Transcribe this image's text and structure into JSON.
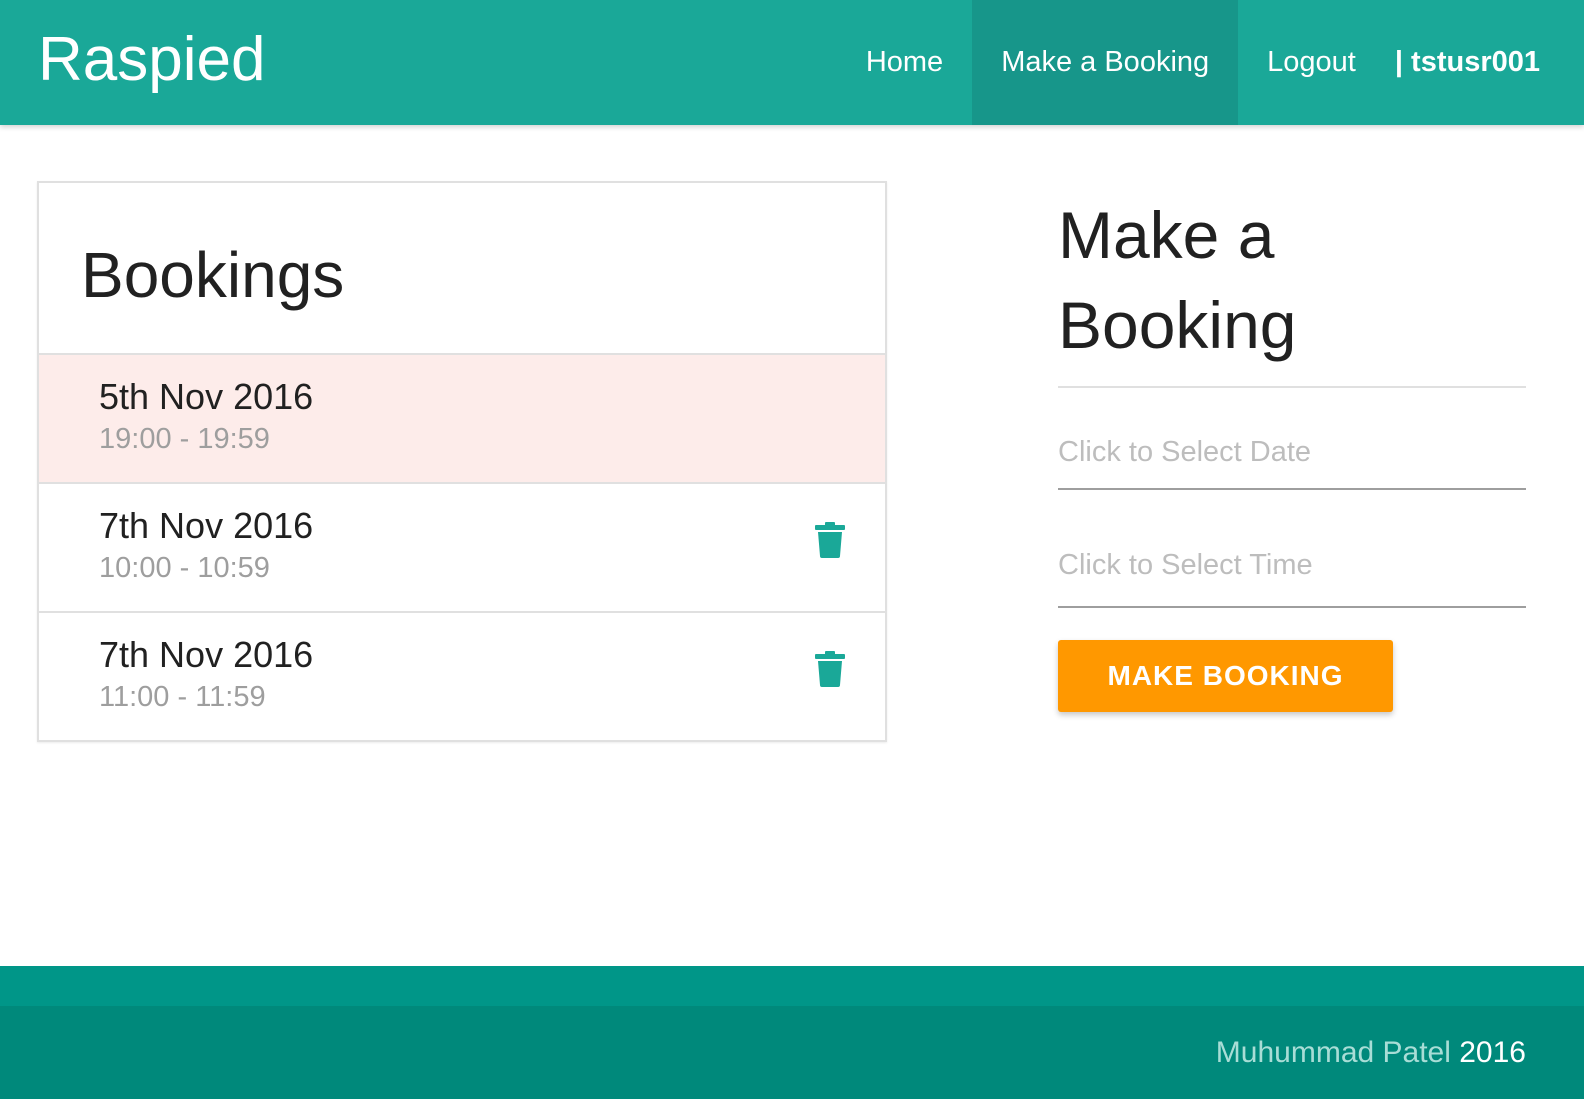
{
  "brand": "Raspied",
  "nav": {
    "home": "Home",
    "make_booking": "Make a Booking",
    "logout": "Logout",
    "user": "| tstusr001"
  },
  "bookings": {
    "title": "Bookings",
    "items": [
      {
        "date": "5th Nov 2016",
        "time": "19:00 - 19:59",
        "status": "past"
      },
      {
        "date": "7th Nov 2016",
        "time": "10:00 - 10:59",
        "status": "upcoming"
      },
      {
        "date": "7th Nov 2016",
        "time": "11:00 - 11:59",
        "status": "upcoming"
      }
    ]
  },
  "form": {
    "title": "Make a Booking",
    "date_placeholder": "Click to Select Date",
    "time_placeholder": "Click to Select Time",
    "submit_label": "MAKE BOOKING"
  },
  "footer": {
    "author": "Muhummad Patel",
    "year": "2016"
  },
  "colors": {
    "primary": "#1aa898",
    "primary_dark": "#17968a",
    "accent": "#ff9800",
    "past_row": "#fdecea",
    "footer": "#009688",
    "footer_dark": "#00897b"
  },
  "icons": {
    "delete": "trash-icon"
  }
}
